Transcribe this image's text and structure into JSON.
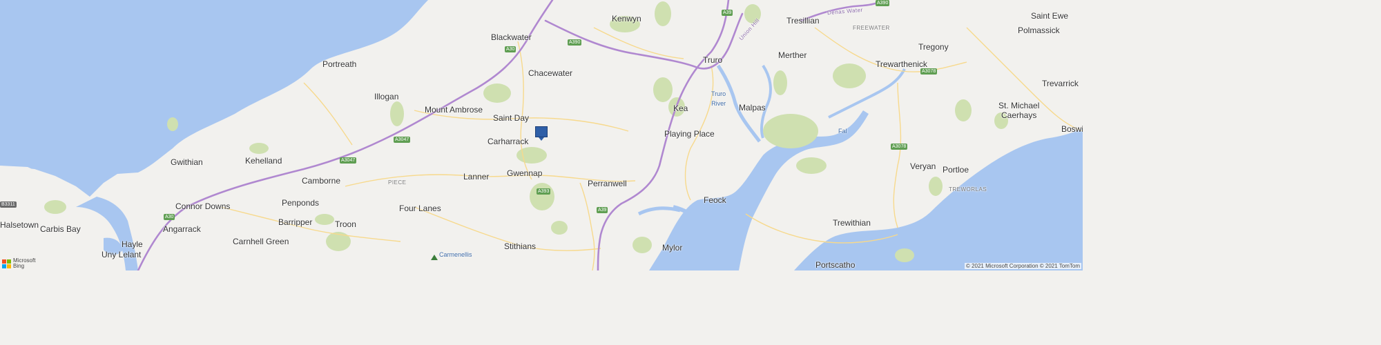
{
  "map": {
    "colors": {
      "water": "#a8c6f0",
      "land": "#f2f1ee",
      "green": "#cfe0b0",
      "motorway": "#b088d0",
      "road": "#f7d98c",
      "pin": "#2f5fa7"
    },
    "places": {
      "kenwyn": "Kenwyn",
      "blackwater": "Blackwater",
      "tresillian": "Tresillian",
      "saint_ewe": "Saint Ewe",
      "polmassick": "Polmassick",
      "freewater": "FREEWATER",
      "portreath": "Portreath",
      "chacewater": "Chacewater",
      "truro": "Truro",
      "merther": "Merther",
      "tregony": "Tregony",
      "trewarthenick": "Trewarthenick",
      "trevarrick": "Trevarrick",
      "illogan": "Illogan",
      "truro_river": "Truro\nRiver",
      "malpas": "Malpas",
      "mount_ambrose": "Mount Ambrose",
      "kea": "Kea",
      "st_michael_caerhays": "St. Michael\nCaerhays",
      "saint_day": "Saint Day",
      "playing_place": "Playing Place",
      "fal": "Fal",
      "boswinger": "Boswi",
      "carharrack": "Carharrack",
      "gwithian": "Gwithian",
      "kehelland": "Kehelland",
      "veryan": "Veryan",
      "portloe": "Portloe",
      "lanner": "Lanner",
      "gwennap": "Gwennap",
      "camborne": "Camborne",
      "piece": "PIECE",
      "perranwell": "Perranwell",
      "treworlas": "TREWORLAS",
      "connor_downs": "Connor Downs",
      "penponds": "Penponds",
      "four_lanes": "Four Lanes",
      "feock": "Feock",
      "halsetown": "Halsetown",
      "carbis_bay": "Carbis Bay",
      "angarrack": "Angarrack",
      "barripper": "Barripper",
      "troon": "Troon",
      "trewithian": "Trewithian",
      "hayle": "Hayle",
      "carnhell_green": "Carnhell Green",
      "stithians": "Stithians",
      "mylor": "Mylor",
      "uny_lelant": "Uny Lelant",
      "carmenellis": "Carmenellis",
      "portscatho": "Portscatho",
      "denas_water": "Denas Water",
      "union_hill": "Union Hill"
    },
    "roads": {
      "a39_top": "A39",
      "a390_top": "A390",
      "a30_blackwater": "A30",
      "a390_mid": "A390",
      "a3078_top": "A3078",
      "a3047_a": "A3047",
      "a3047_b": "A3047",
      "a3078_mid": "A3078",
      "a393": "A393",
      "a39_south": "A39",
      "b3311": "B3311",
      "a30_west": "A30"
    },
    "logo_text": "Microsoft\nBing",
    "copyright": "© 2021 Microsoft Corporation © 2021 TomTom"
  }
}
